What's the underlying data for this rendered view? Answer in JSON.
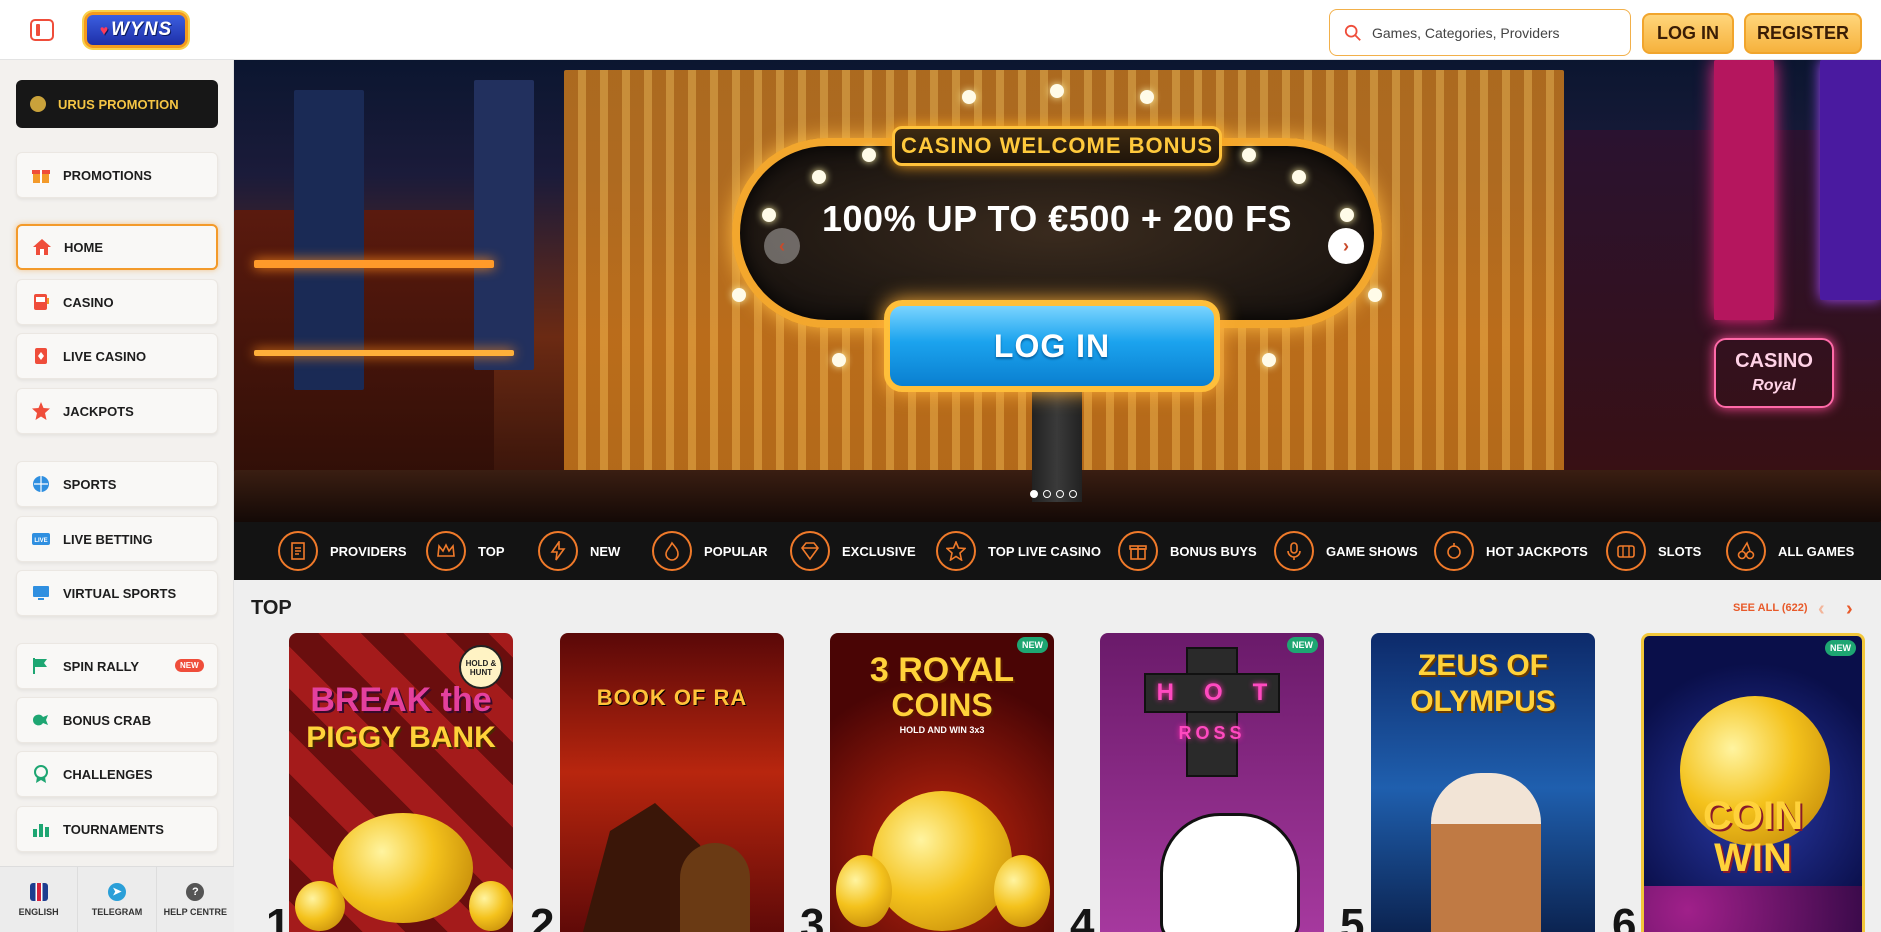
{
  "header": {
    "logo_text": "WYNS",
    "search": {
      "placeholder": "Games, Categories, Providers"
    },
    "login_label": "LOG IN",
    "register_label": "REGISTER",
    "accent_color": "#f6b23d"
  },
  "sidebar": {
    "promo_top": "URUS PROMOTION",
    "items": [
      {
        "label": "PROMOTIONS",
        "icon": "gift-icon"
      },
      {
        "label": "HOME",
        "icon": "home-icon"
      },
      {
        "label": "CASINO",
        "icon": "slot-machine-icon"
      },
      {
        "label": "LIVE CASINO",
        "icon": "cards-icon"
      },
      {
        "label": "JACKPOTS",
        "icon": "jackpot-icon"
      },
      {
        "label": "SPORTS",
        "icon": "ball-icon"
      },
      {
        "label": "LIVE BETTING",
        "icon": "live-icon"
      },
      {
        "label": "VIRTUAL SPORTS",
        "icon": "monitor-icon"
      },
      {
        "label": "SPIN RALLY",
        "icon": "flag-icon",
        "badge": "NEW"
      },
      {
        "label": "BONUS CRAB",
        "icon": "crab-icon"
      },
      {
        "label": "CHALLENGES",
        "icon": "medal-icon"
      },
      {
        "label": "TOURNAMENTS",
        "icon": "trophy-icon"
      }
    ],
    "footer": [
      {
        "label": "ENGLISH",
        "icon": "uk-flag-icon"
      },
      {
        "label": "TELEGRAM",
        "icon": "telegram-icon"
      },
      {
        "label": "HELP CENTRE",
        "icon": "help-icon"
      }
    ]
  },
  "banner": {
    "sign_title": "CASINO WELCOME BONUS",
    "offer": "100% UP TO €500 + 200 FS",
    "cta_label": "LOG IN",
    "sign_text_right": "CASINO",
    "sign_text_right_script": "Royal",
    "slides_total": 4,
    "active_slide": 1
  },
  "categories": [
    {
      "label": "PROVIDERS",
      "icon": "document-icon"
    },
    {
      "label": "TOP",
      "icon": "crown-icon"
    },
    {
      "label": "NEW",
      "icon": "lightning-icon"
    },
    {
      "label": "POPULAR",
      "icon": "fire-icon"
    },
    {
      "label": "EXCLUSIVE",
      "icon": "diamond-icon"
    },
    {
      "label": "TOP LIVE CASINO",
      "icon": "star-icon"
    },
    {
      "label": "BONUS BUYS",
      "icon": "gift-icon"
    },
    {
      "label": "GAME SHOWS",
      "icon": "microphone-icon"
    },
    {
      "label": "HOT JACKPOTS",
      "icon": "hot-icon"
    },
    {
      "label": "SLOTS",
      "icon": "slot-icon"
    },
    {
      "label": "ALL GAMES",
      "icon": "cherries-icon"
    }
  ],
  "top_section": {
    "title": "TOP",
    "see_all": "SEE ALL (622)",
    "games": [
      {
        "rank": "1",
        "title_line1": "BREAK the",
        "title_line2": "PIGGY BANK",
        "badge": "HOLD & HUNT",
        "new": false
      },
      {
        "rank": "2",
        "title_line1": "BOOK OF RA",
        "title_line2": "",
        "badge": "",
        "new": false
      },
      {
        "rank": "3",
        "title_line1": "3 ROYAL",
        "title_line2": "COINS",
        "badge": "HOLD AND WIN 3x3",
        "new": true
      },
      {
        "rank": "4",
        "title_line1": "HOT",
        "title_line2": "ROSS",
        "badge": "",
        "new": true
      },
      {
        "rank": "5",
        "title_line1": "ZEUS OF",
        "title_line2": "OLYMPUS",
        "badge": "",
        "new": false
      },
      {
        "rank": "6",
        "title_line1": "COIN",
        "title_line2": "WIN",
        "badge": "",
        "new": true
      }
    ],
    "new_label": "NEW"
  }
}
